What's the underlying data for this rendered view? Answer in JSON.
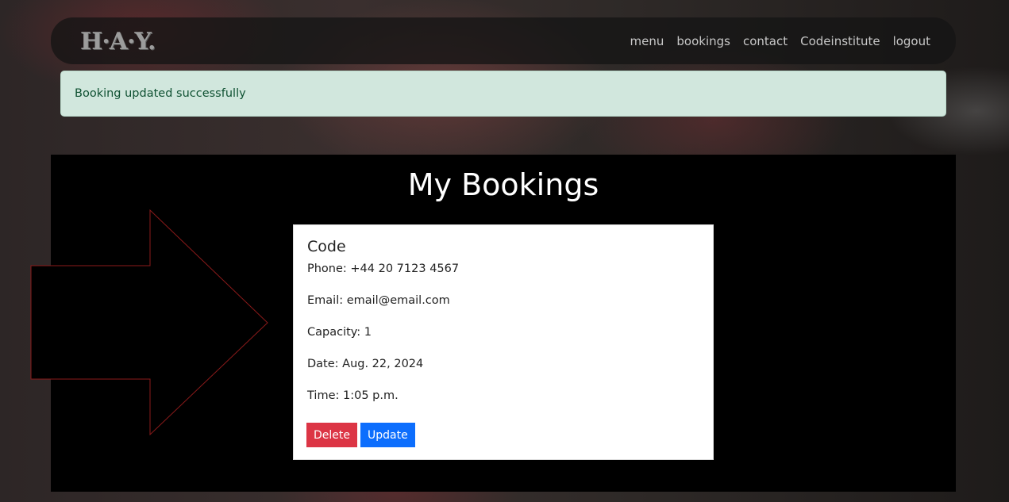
{
  "brand": "H·A·Y.",
  "nav": {
    "items": [
      "menu",
      "bookings",
      "contact",
      "Codeinstitute",
      "logout"
    ]
  },
  "alert": {
    "message": "Booking updated successfully"
  },
  "page": {
    "title": "My Bookings"
  },
  "booking": {
    "name": "Code",
    "phone": "Phone: +44 20 7123 4567",
    "email": "Email: email@email.com",
    "capacity": "Capacity: 1",
    "date": "Date: Aug. 22, 2024",
    "time": "Time: 1:05 p.m.",
    "delete_label": "Delete",
    "update_label": "Update"
  },
  "colors": {
    "alert_bg": "#d1e7dd",
    "delete": "#dc3545",
    "update": "#0d6efd",
    "arrow_stroke": "#8b1a1a"
  }
}
